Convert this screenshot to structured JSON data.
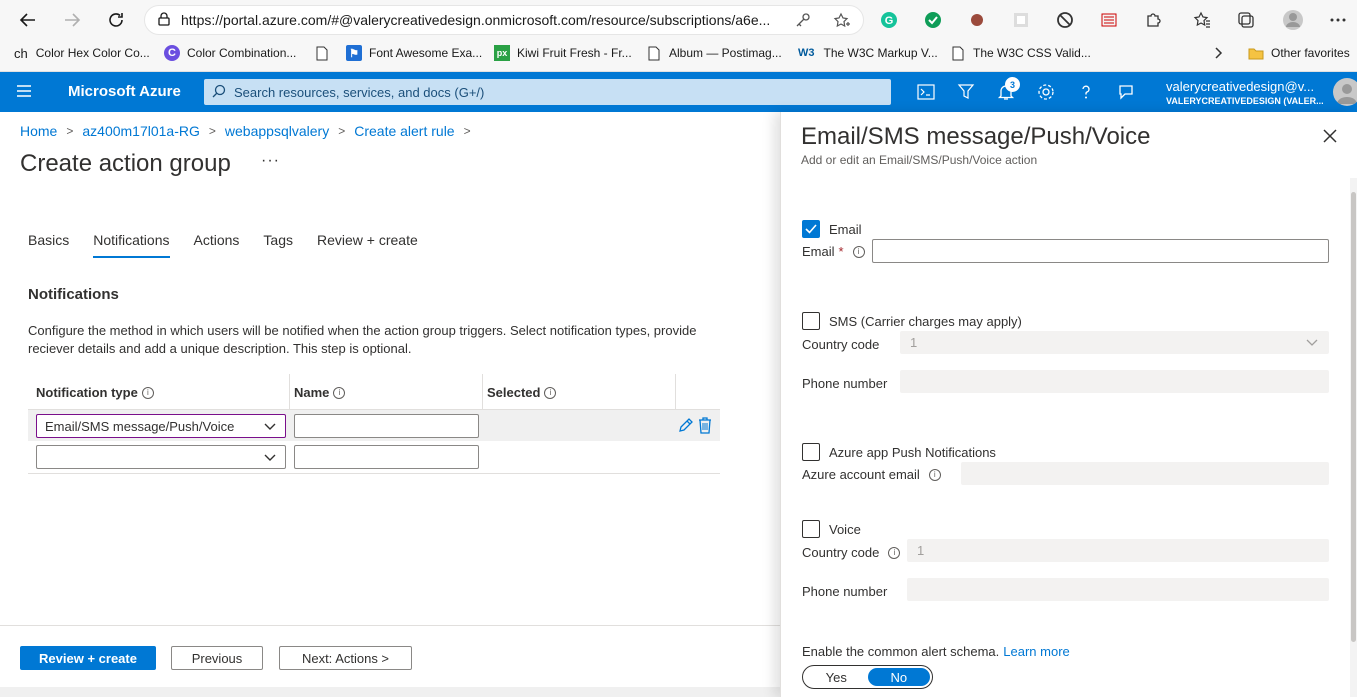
{
  "browser": {
    "url_prefix": "https://",
    "url_host": "portal.azure.com",
    "url_rest": "/#@valerycreativedesign.onmicrosoft.com/resource/subscriptions/a6e...",
    "bookmarks": [
      {
        "label": "Color Hex Color Co...",
        "icon": "ch"
      },
      {
        "label": "Color Combination...",
        "icon": "C"
      },
      {
        "label": "Font Awesome Exa...",
        "icon": "flag"
      },
      {
        "label": "Kiwi Fruit Fresh - Fr...",
        "icon": "px"
      },
      {
        "label": "Album — Postimag...",
        "icon": "page"
      },
      {
        "label": "The W3C Markup V...",
        "icon": "W3"
      },
      {
        "label": "The W3C CSS Valid...",
        "icon": "page"
      }
    ],
    "other_favorites": "Other favorites"
  },
  "azure": {
    "brand": "Microsoft Azure",
    "search_placeholder": "Search resources, services, and docs (G+/)",
    "notification_count": "3",
    "account_name": "valerycreativedesign@v...",
    "account_org": "VALERYCREATIVEDESIGN (VALER..."
  },
  "breadcrumb": [
    "Home",
    "az400m17l01a-RG",
    "webappsqlvalery",
    "Create alert rule"
  ],
  "page": {
    "title": "Create action group",
    "more": "···",
    "tabs": [
      "Basics",
      "Notifications",
      "Actions",
      "Tags",
      "Review + create"
    ],
    "active_tab": "Notifications",
    "section_title": "Notifications",
    "description": "Configure the method in which users will be notified when the action group triggers. Select notification types, provide reciever details and add a unique description. This step is optional.",
    "table": {
      "headers": [
        "Notification type",
        "Name",
        "Selected"
      ],
      "rows": [
        {
          "type": "Email/SMS message/Push/Voice",
          "name": "",
          "selected": ""
        },
        {
          "type": "",
          "name": "",
          "selected": ""
        }
      ]
    },
    "footer": {
      "review": "Review + create",
      "previous": "Previous",
      "next": "Next: Actions >"
    }
  },
  "panel": {
    "title": "Email/SMS message/Push/Voice",
    "subtitle": "Add or edit an Email/SMS/Push/Voice action",
    "email": {
      "checkbox_label": "Email",
      "checked": true,
      "field_label": "Email",
      "value": ""
    },
    "sms": {
      "checkbox_label": "SMS (Carrier charges may apply)",
      "checked": false,
      "country_label": "Country code",
      "country_value": "1",
      "phone_label": "Phone number"
    },
    "push": {
      "checkbox_label": "Azure app Push Notifications",
      "checked": false,
      "account_label": "Azure account email"
    },
    "voice": {
      "checkbox_label": "Voice",
      "checked": false,
      "country_label": "Country code",
      "country_value": "1",
      "phone_label": "Phone number"
    },
    "schema_label": "Enable the common alert schema.",
    "learn_more": "Learn more",
    "toggle": {
      "yes": "Yes",
      "no": "No",
      "selected": "No"
    }
  },
  "colors": {
    "accent": "#0078d4",
    "header": "#0078d4",
    "focus_border": "#7a0f8b"
  }
}
